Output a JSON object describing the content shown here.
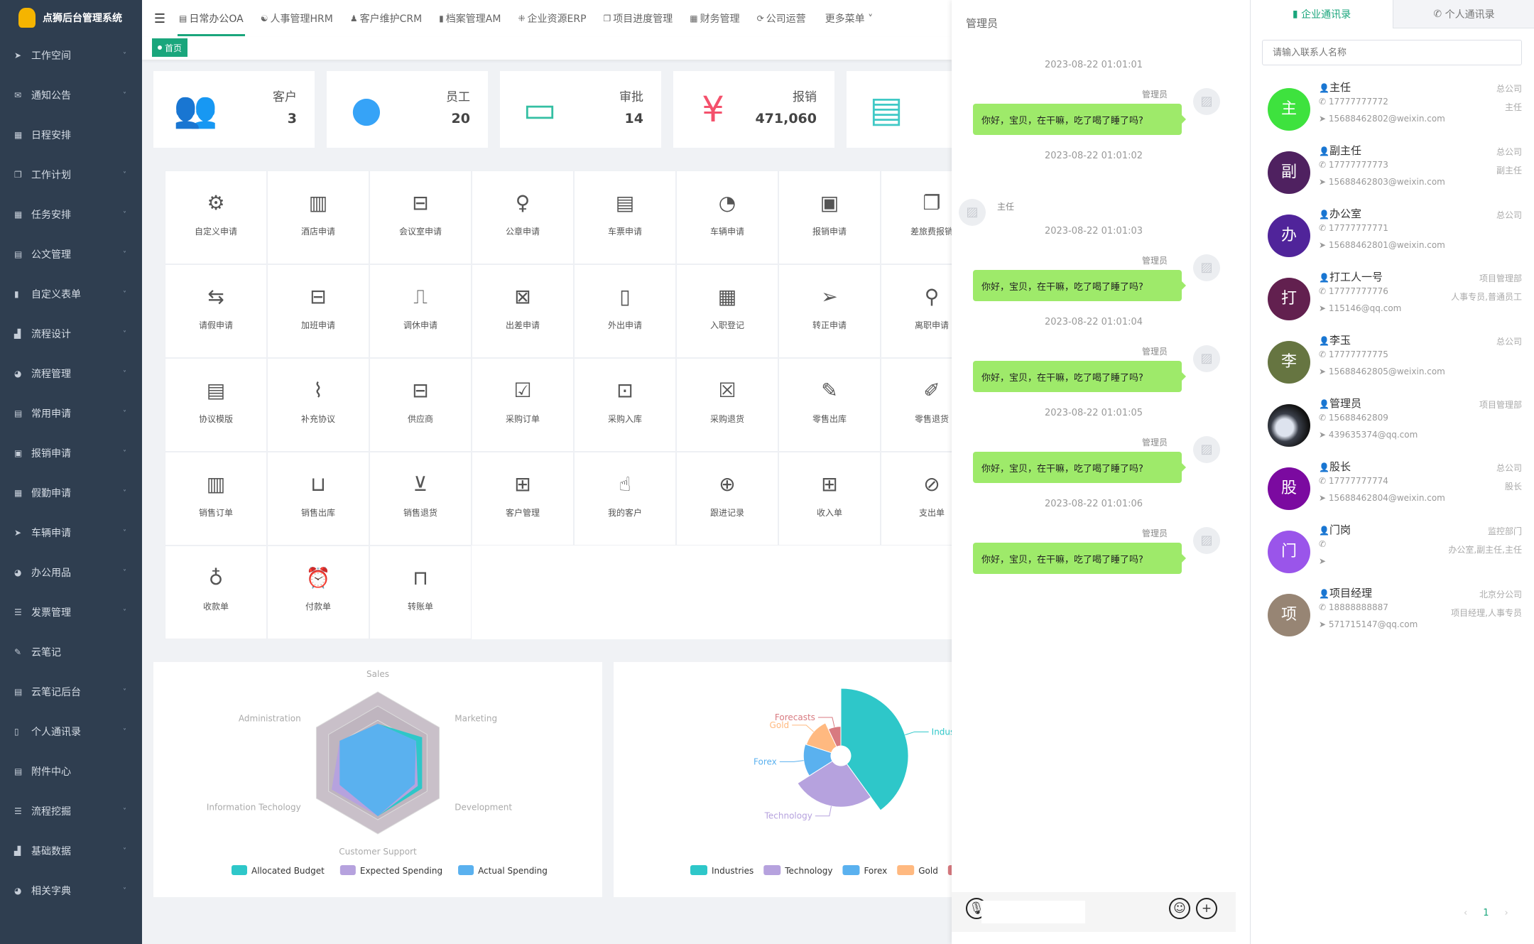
{
  "app": {
    "title": "点狮后台管理系统"
  },
  "sidebar": {
    "items": [
      {
        "label": "工作空间",
        "icon": "send-icon",
        "g": "➤",
        "chev": true
      },
      {
        "label": "通知公告",
        "icon": "envelope-icon",
        "g": "✉",
        "chev": true
      },
      {
        "label": "日程安排",
        "icon": "calendar-icon",
        "g": "▦",
        "chev": false
      },
      {
        "label": "工作计划",
        "icon": "copy-icon",
        "g": "❐",
        "chev": true
      },
      {
        "label": "任务安排",
        "icon": "calendar-icon",
        "g": "▦",
        "chev": true
      },
      {
        "label": "公文管理",
        "icon": "file-icon",
        "g": "▤",
        "chev": true
      },
      {
        "label": "自定义表单",
        "icon": "book-icon",
        "g": "▮",
        "chev": true
      },
      {
        "label": "流程设计",
        "icon": "bar-chart-icon",
        "g": "▟",
        "chev": true
      },
      {
        "label": "流程管理",
        "icon": "dashboard-icon",
        "g": "◕",
        "chev": true
      },
      {
        "label": "常用申请",
        "icon": "file-icon",
        "g": "▤",
        "chev": true
      },
      {
        "label": "报销申请",
        "icon": "camera-icon",
        "g": "▣",
        "chev": true
      },
      {
        "label": "假勤申请",
        "icon": "table-icon",
        "g": "▦",
        "chev": true
      },
      {
        "label": "车辆申请",
        "icon": "send-icon",
        "g": "➤",
        "chev": true
      },
      {
        "label": "办公用品",
        "icon": "dashboard-icon",
        "g": "◕",
        "chev": true
      },
      {
        "label": "发票管理",
        "icon": "list-icon",
        "g": "☰",
        "chev": true
      },
      {
        "label": "云笔记",
        "icon": "edit-icon",
        "g": "✎",
        "chev": false
      },
      {
        "label": "云笔记后台",
        "icon": "file-icon",
        "g": "▤",
        "chev": true
      },
      {
        "label": "个人通讯录",
        "icon": "book-open-icon",
        "g": "▯",
        "chev": true
      },
      {
        "label": "附件中心",
        "icon": "file-icon",
        "g": "▤",
        "chev": false
      },
      {
        "label": "流程挖掘",
        "icon": "list-icon",
        "g": "☰",
        "chev": true
      },
      {
        "label": "基础数据",
        "icon": "bar-chart-icon",
        "g": "▟",
        "chev": true
      },
      {
        "label": "相关字典",
        "icon": "dashboard-icon",
        "g": "◕",
        "chev": true
      }
    ]
  },
  "topnav": {
    "tabs": [
      {
        "label": "日常办公OA",
        "g": "▤",
        "active": true
      },
      {
        "label": "人事管理HRM",
        "g": "☯"
      },
      {
        "label": "客户维护CRM",
        "g": "♟"
      },
      {
        "label": "档案管理AM",
        "g": "▮"
      },
      {
        "label": "企业资源ERP",
        "g": "⁜"
      },
      {
        "label": "项目进度管理",
        "g": "❐"
      },
      {
        "label": "财务管理",
        "g": "▦"
      },
      {
        "label": "公司运营",
        "g": "⟳"
      },
      {
        "label": "更多菜单 ˅",
        "g": ""
      }
    ]
  },
  "tag": {
    "label": "首页"
  },
  "stats": [
    {
      "label": "客户",
      "value": "3",
      "icon": "users-icon",
      "color": "#40c9c6"
    },
    {
      "label": "员工",
      "value": "20",
      "icon": "user-icon",
      "color": "#36a3f7"
    },
    {
      "label": "审批",
      "value": "14",
      "icon": "tablet-icon",
      "color": "#34bfa3"
    },
    {
      "label": "报销",
      "value": "471,060",
      "icon": "yen-icon",
      "color": "#f4516c"
    },
    {
      "label": "",
      "value": "",
      "icon": "document-check-icon",
      "color": "#40c9c6"
    }
  ],
  "grid": [
    {
      "label": "自定义申请",
      "g": "⚙"
    },
    {
      "label": "酒店申请",
      "g": "▥"
    },
    {
      "label": "会议室申请",
      "g": "⊟"
    },
    {
      "label": "公章申请",
      "g": "♀"
    },
    {
      "label": "车票申请",
      "g": "▤"
    },
    {
      "label": "车辆申请",
      "g": "◔"
    },
    {
      "label": "报销申请",
      "g": "▣"
    },
    {
      "label": "差旅费报销",
      "g": "❐"
    },
    {
      "label": "请假申请",
      "g": "⇆"
    },
    {
      "label": "加班申请",
      "g": "⊟"
    },
    {
      "label": "调休申请",
      "g": "⎍"
    },
    {
      "label": "出差申请",
      "g": "⊠"
    },
    {
      "label": "外出申请",
      "g": "▯"
    },
    {
      "label": "入职登记",
      "g": "▦"
    },
    {
      "label": "转正申请",
      "g": "➢"
    },
    {
      "label": "离职申请",
      "g": "⚲"
    },
    {
      "label": "协议模版",
      "g": "▤"
    },
    {
      "label": "补充协议",
      "g": "⌇"
    },
    {
      "label": "供应商",
      "g": "⊟"
    },
    {
      "label": "采购订单",
      "g": "☑"
    },
    {
      "label": "采购入库",
      "g": "⊡"
    },
    {
      "label": "采购退货",
      "g": "☒"
    },
    {
      "label": "零售出库",
      "g": "✎"
    },
    {
      "label": "零售退货",
      "g": "✐"
    },
    {
      "label": "销售订单",
      "g": "▥"
    },
    {
      "label": "销售出库",
      "g": "⊔"
    },
    {
      "label": "销售退货",
      "g": "⊻"
    },
    {
      "label": "客户管理",
      "g": "⊞"
    },
    {
      "label": "我的客户",
      "g": "☝"
    },
    {
      "label": "跟进记录",
      "g": "⊕"
    },
    {
      "label": "收入单",
      "g": "⊞"
    },
    {
      "label": "支出单",
      "g": "⊘"
    },
    {
      "label": "收款单",
      "g": "♁"
    },
    {
      "label": "付款单",
      "g": "⏰"
    },
    {
      "label": "转账单",
      "g": "⊓"
    }
  ],
  "chart_data": [
    {
      "type": "radar",
      "indicators": [
        "Sales",
        "Marketing",
        "Development",
        "Customer Support",
        "Information Techology",
        "Administration"
      ],
      "max": 100,
      "series": [
        {
          "name": "Allocated Budget",
          "color": "#2ec7c9",
          "values": [
            55,
            72,
            72,
            75,
            62,
            62
          ]
        },
        {
          "name": "Expected Spending",
          "color": "#b6a2de",
          "values": [
            55,
            62,
            65,
            75,
            75,
            62
          ]
        },
        {
          "name": "Actual Spending",
          "color": "#5ab1ef",
          "values": [
            55,
            62,
            60,
            75,
            62,
            62
          ]
        }
      ],
      "legend": "bottom"
    },
    {
      "type": "pie",
      "rose": "radius",
      "series": [
        {
          "name": "Industries",
          "value": 40,
          "color": "#2ec7c9"
        },
        {
          "name": "Technology",
          "value": 26,
          "color": "#b6a2de"
        },
        {
          "name": "Forex",
          "value": 14,
          "color": "#5ab1ef"
        },
        {
          "name": "Gold",
          "value": 13,
          "color": "#ffb980"
        },
        {
          "name": "Forecasts",
          "value": 7,
          "color": "#d87a80"
        }
      ],
      "legend": "bottom"
    }
  ],
  "chat": {
    "title": "管理员",
    "messages": [
      {
        "time": "2023-08-22 01:01:01",
        "sender": "管理员",
        "text": "你好，宝贝，在干嘛，吃了喝了睡了吗?",
        "mine": true
      },
      {
        "time": "2023-08-22 01:01:02",
        "sender": "主任",
        "text": "",
        "mine": false
      },
      {
        "time": "2023-08-22 01:01:03",
        "sender": "管理员",
        "text": "你好，宝贝，在干嘛，吃了喝了睡了吗?",
        "mine": true
      },
      {
        "time": "2023-08-22 01:01:04",
        "sender": "管理员",
        "text": "你好，宝贝，在干嘛，吃了喝了睡了吗?",
        "mine": true
      },
      {
        "time": "2023-08-22 01:01:05",
        "sender": "管理员",
        "text": "你好，宝贝，在干嘛，吃了喝了睡了吗?",
        "mine": true
      },
      {
        "time": "2023-08-22 01:01:06",
        "sender": "管理员",
        "text": "你好，宝贝，在干嘛，吃了喝了睡了吗?",
        "mine": true
      }
    ]
  },
  "contacts": {
    "tabs": [
      "企业通讯录",
      "个人通讯录"
    ],
    "search_placeholder": "请输入联系人名称",
    "items": [
      {
        "avatar": "主",
        "color": "#3ee23e",
        "name": "主任",
        "phone": "17777777772",
        "email": "15688462802@weixin.com",
        "dept": "总公司",
        "role": "主任",
        "pcolor": "#36a3f7"
      },
      {
        "avatar": "副",
        "color": "#4f2160",
        "name": "副主任",
        "phone": "17777777773",
        "email": "15688462803@weixin.com",
        "dept": "总公司",
        "role": "副主任",
        "pcolor": "#36a3f7"
      },
      {
        "avatar": "办",
        "color": "#50249a",
        "name": "办公室",
        "phone": "17777777771",
        "email": "15688462801@weixin.com",
        "dept": "总公司",
        "role": "",
        "pcolor": "#36a3f7"
      },
      {
        "avatar": "打",
        "color": "#62204f",
        "name": "打工人一号",
        "phone": "17777777776",
        "email": "115146@qq.com",
        "dept": "项目管理部",
        "role": "人事专员,普通员工",
        "pcolor": "#f4516c"
      },
      {
        "avatar": "李",
        "color": "#667541",
        "name": "李玉",
        "phone": "17777777775",
        "email": "15688462805@weixin.com",
        "dept": "总公司",
        "role": "",
        "pcolor": "#36a3f7"
      },
      {
        "avatar": "",
        "color": "#223",
        "name": "管理员",
        "phone": "15688462809",
        "email": "439635374@qq.com",
        "dept": "项目管理部",
        "role": "",
        "pcolor": "#f4516c"
      },
      {
        "avatar": "股",
        "color": "#7b0aa0",
        "name": "股长",
        "phone": "17777777774",
        "email": "15688462804@weixin.com",
        "dept": "总公司",
        "role": "股长",
        "pcolor": "#36a3f7"
      },
      {
        "avatar": "门",
        "color": "#9a55ea",
        "name": "门岗",
        "phone": "",
        "email": "",
        "dept": "监控部门",
        "role": "办公室,副主任,主任",
        "pcolor": "#36a3f7"
      },
      {
        "avatar": "项",
        "color": "#978574",
        "name": "项目经理",
        "phone": "18888888887",
        "email": "571715147@qq.com",
        "dept": "北京分公司",
        "role": "项目经理,人事专员",
        "pcolor": "#36a3f7"
      }
    ],
    "page": "1"
  }
}
